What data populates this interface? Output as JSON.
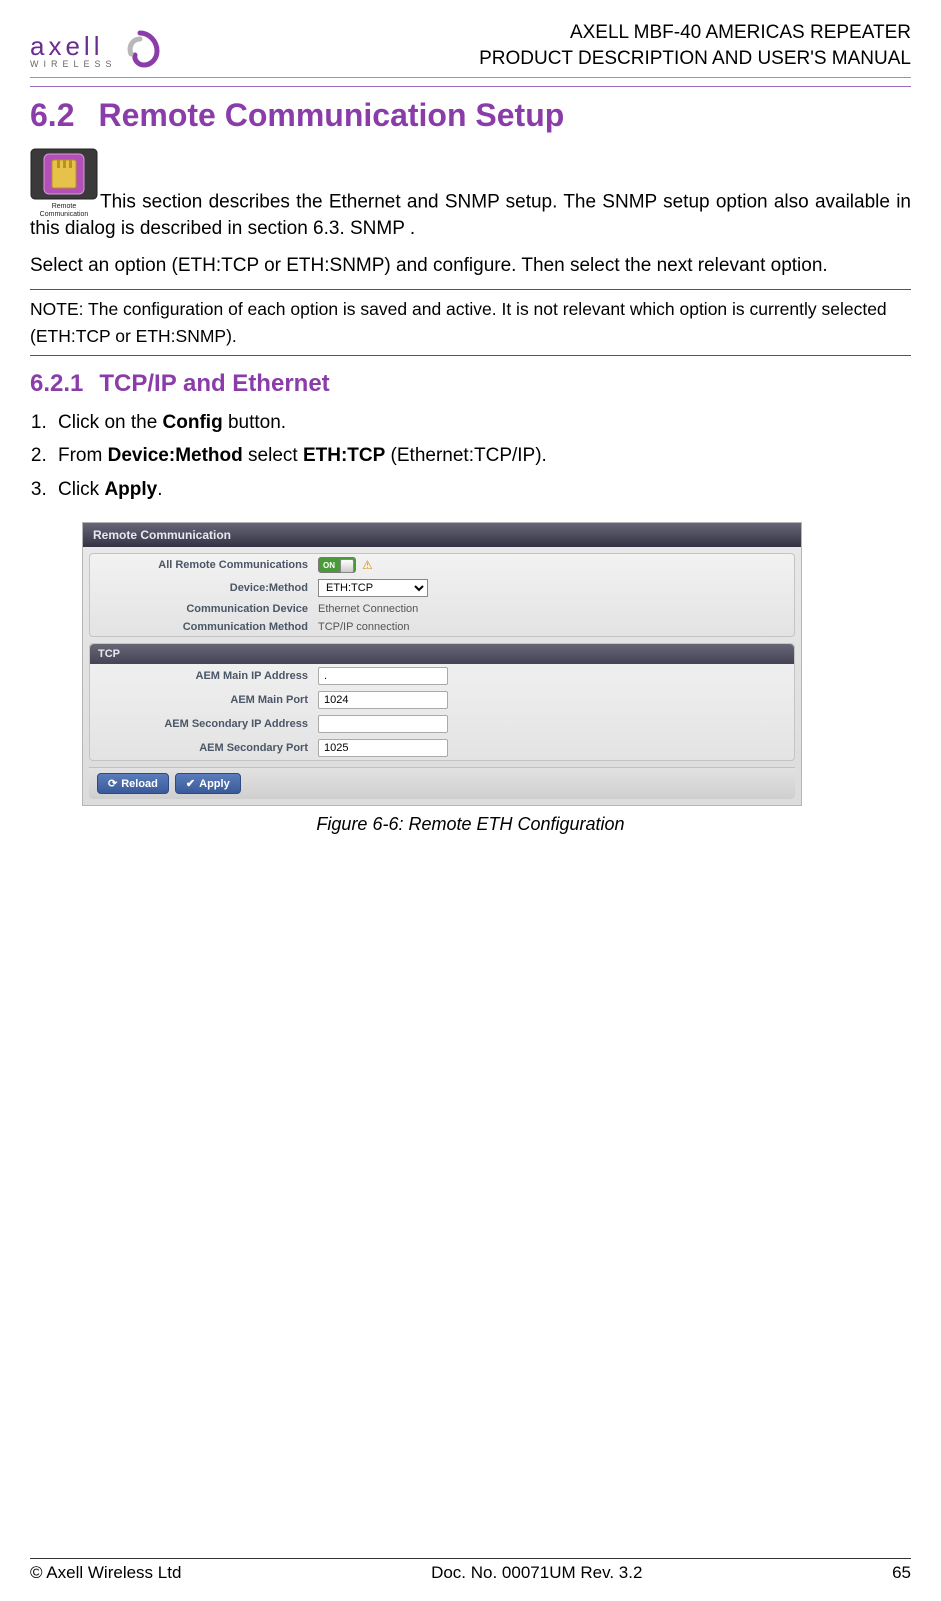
{
  "header": {
    "brand_main": "axell",
    "brand_sub": "WIRELESS",
    "title_line1": "AXELL MBF-40 AMERICAS REPEATER",
    "title_line2": "PRODUCT DESCRIPTION AND USER'S MANUAL"
  },
  "section": {
    "num": "6.2",
    "title": "Remote Communication Setup"
  },
  "icon_label": "Remote Communication",
  "para1": "This section describes the Ethernet and SNMP setup. The SNMP setup option also available in this dialog is described in section 6.3. SNMP .",
  "para2": "Select an option (ETH:TCP or ETH:SNMP) and configure. Then select the next relevant option.",
  "note": "NOTE: The configuration of each option is saved and active. It is not relevant which option is currently selected (ETH:TCP or ETH:SNMP).",
  "subsection": {
    "num": "6.2.1",
    "title": "TCP/IP and Ethernet"
  },
  "steps": {
    "s1a": "Click on the ",
    "s1b": "Config",
    "s1c": " button.",
    "s2a": "From ",
    "s2b": "Device:Method",
    "s2c": " select ",
    "s2d": "ETH:TCP",
    "s2e": " (Ethernet:TCP/IP).",
    "s3a": "Click ",
    "s3b": "Apply",
    "s3c": "."
  },
  "mock": {
    "titlebar": "Remote Communication",
    "labels": {
      "all_remote": "All Remote Communications",
      "device_method": "Device:Method",
      "comm_device": "Communication Device",
      "comm_method": "Communication Method",
      "tcp_header": "TCP",
      "main_ip": "AEM Main IP Address",
      "main_port": "AEM Main Port",
      "sec_ip": "AEM Secondary IP Address",
      "sec_port": "AEM Secondary Port"
    },
    "values": {
      "toggle": "ON",
      "device_method": "ETH:TCP",
      "comm_device": "Ethernet Connection",
      "comm_method": "TCP/IP connection",
      "main_ip": ".",
      "main_port": "1024",
      "sec_ip": "",
      "sec_port": "1025"
    },
    "buttons": {
      "reload": "Reload",
      "apply": "Apply"
    }
  },
  "figure_caption": "Figure 6-6:  Remote ETH Configuration",
  "footer": {
    "left": "© Axell Wireless Ltd",
    "center": "Doc. No. 00071UM Rev. 3.2",
    "right": "65"
  }
}
